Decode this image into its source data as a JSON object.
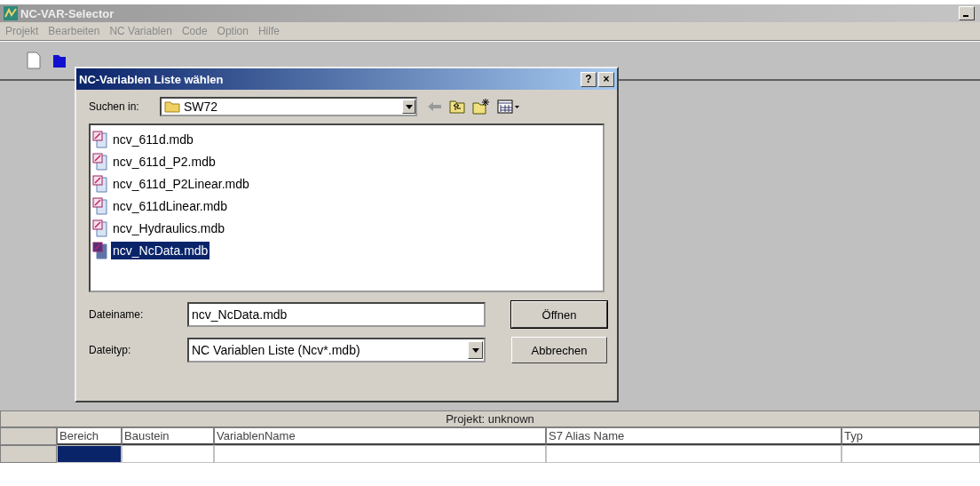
{
  "window": {
    "title": "NC-VAR-Selector"
  },
  "menu": [
    {
      "label": "Projekt",
      "disabled": true
    },
    {
      "label": "Bearbeiten",
      "disabled": true
    },
    {
      "label": "NC Variablen",
      "disabled": true
    },
    {
      "label": "Code",
      "disabled": true
    },
    {
      "label": "Option",
      "disabled": true
    },
    {
      "label": "Hilfe",
      "disabled": true
    }
  ],
  "dialog": {
    "title": "NC-Variablen Liste wählen",
    "help_button": "?",
    "close_button": "×",
    "look_in_label": "Suchen in:",
    "look_in_value": "SW72",
    "files": [
      {
        "name": "ncv_611d.mdb",
        "selected": false
      },
      {
        "name": "ncv_611d_P2.mdb",
        "selected": false
      },
      {
        "name": "ncv_611d_P2Linear.mdb",
        "selected": false
      },
      {
        "name": "ncv_611dLinear.mdb",
        "selected": false
      },
      {
        "name": "ncv_Hydraulics.mdb",
        "selected": false
      },
      {
        "name": "ncv_NcData.mdb",
        "selected": true
      }
    ],
    "filename_label": "Dateiname:",
    "filename_value": "ncv_NcData.mdb",
    "filetype_label": "Dateityp:",
    "filetype_value": "NC Variablen Liste (Ncv*.mdb)",
    "open_button": "Öffnen",
    "cancel_button": "Abbrechen"
  },
  "project_bar": "Projekt:  unknown",
  "table": {
    "columns": [
      "Bereich",
      "Baustein",
      "VariablenName",
      "S7 Alias Name",
      "Typ"
    ]
  }
}
